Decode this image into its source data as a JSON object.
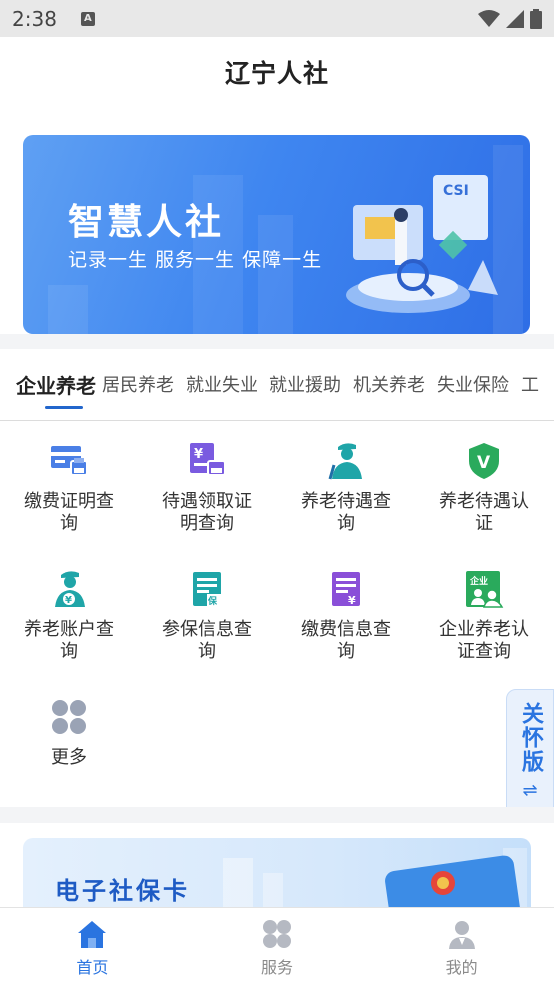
{
  "status_bar": {
    "time": "2:38",
    "notification_icon": "a-notification-icon"
  },
  "header": {
    "title": "辽宁人社"
  },
  "banner": {
    "title": "智慧人社",
    "subtitle": "记录一生  服务一生  保障一生"
  },
  "tabs": [
    {
      "label": "企业养老",
      "active": true
    },
    {
      "label": "居民养老"
    },
    {
      "label": "就业失业"
    },
    {
      "label": "就业援助"
    },
    {
      "label": "机关养老"
    },
    {
      "label": "失业保险"
    },
    {
      "label": "工"
    }
  ],
  "services": [
    {
      "label_line1": "缴费证明查",
      "label_line2": "询",
      "icon": "card-print-icon",
      "color": "#4a7fe6"
    },
    {
      "label_line1": "待遇领取证",
      "label_line2": "明查询",
      "icon": "yuan-print-icon",
      "color": "#7a5be0"
    },
    {
      "label_line1": "养老待遇查",
      "label_line2": "询",
      "icon": "elder-person-icon",
      "color": "#1fa5a8"
    },
    {
      "label_line1": "养老待遇认",
      "label_line2": "证",
      "icon": "shield-v-icon",
      "color": "#2aaa5c"
    },
    {
      "label_line1": "养老账户查",
      "label_line2": "询",
      "icon": "elder-account-icon",
      "color": "#1fa5a8"
    },
    {
      "label_line1": "参保信息查",
      "label_line2": "询",
      "icon": "insurance-doc-icon",
      "color": "#1fa5a8"
    },
    {
      "label_line1": "缴费信息查",
      "label_line2": "询",
      "icon": "payment-doc-icon",
      "color": "#8a4fd8"
    },
    {
      "label_line1": "企业养老认",
      "label_line2": "证查询",
      "icon": "enterprise-cert-icon",
      "color": "#2aaa5c",
      "badge": "企业"
    },
    {
      "label_line1": "更多",
      "label_line2": "",
      "icon": "more-grid-icon",
      "color": "#9aa3b5"
    }
  ],
  "care_mode": {
    "label": "关怀版",
    "arrow": "⇌"
  },
  "social_card": {
    "title": "电子社保卡"
  },
  "bottom_nav": [
    {
      "label": "首页",
      "icon": "home-icon",
      "active": true
    },
    {
      "label": "服务",
      "icon": "service-grid-icon"
    },
    {
      "label": "我的",
      "icon": "profile-icon"
    }
  ],
  "colors": {
    "accent": "#2a74e0",
    "tab_underline": "#2266cc"
  }
}
